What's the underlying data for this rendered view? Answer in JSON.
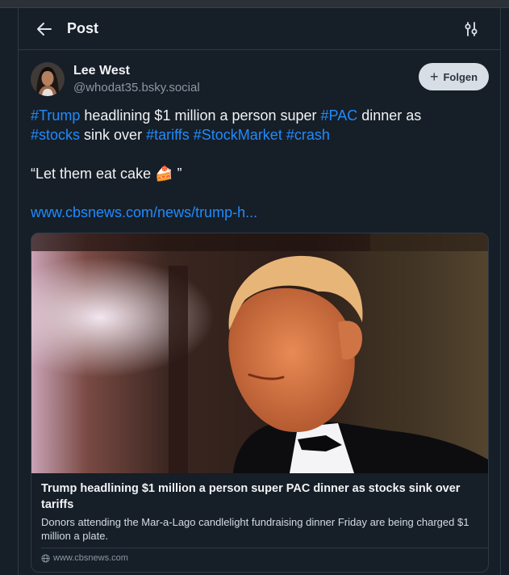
{
  "header": {
    "title": "Post"
  },
  "author": {
    "name": "Lee West",
    "handle": "@whodat35.bsky.social"
  },
  "follow_button": {
    "label": "Folgen"
  },
  "post": {
    "line1": [
      {
        "text": "#Trump",
        "tag": true
      },
      {
        "text": " headlining $1 million a person super ",
        "tag": false
      },
      {
        "text": "#PAC",
        "tag": true
      },
      {
        "text": " dinner as",
        "tag": false
      }
    ],
    "line2": [
      {
        "text": "#stocks",
        "tag": true
      },
      {
        "text": " sink over ",
        "tag": false
      },
      {
        "text": "#tariffs",
        "tag": true
      },
      {
        "text": " ",
        "tag": false
      },
      {
        "text": "#StockMarket",
        "tag": true
      },
      {
        "text": " ",
        "tag": false
      },
      {
        "text": "#crash",
        "tag": true
      }
    ],
    "quote": "“Let them eat cake 🍰 ”",
    "link": "www.cbsnews.com/news/trump-h..."
  },
  "card": {
    "title": "Trump headlining $1 million a person super PAC dinner as stocks sink over tariffs",
    "description": "Donors attending the Mar-a-Lago candlelight fundraising dinner Friday are being charged $1 million a plate.",
    "domain": "www.cbsnews.com"
  },
  "icons": {
    "back": "arrow-left-icon",
    "filter": "sliders-icon",
    "follow": "plus-icon",
    "domain": "globe-icon"
  },
  "colors": {
    "background": "#161e27",
    "accent": "#208bfe",
    "border": "#2e3a47",
    "muted": "#8b98a5",
    "follow_bg": "#d7dee6"
  }
}
